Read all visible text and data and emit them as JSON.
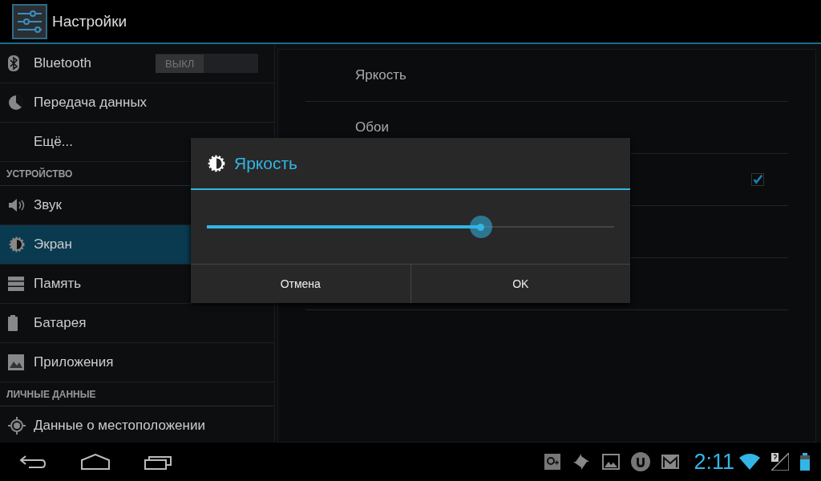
{
  "action_bar": {
    "title": "Настройки"
  },
  "sidebar": {
    "items": [
      {
        "kind": "item",
        "label": "Bluetooth",
        "selected": false,
        "toggle": {
          "label": "ВЫКЛ",
          "on": false
        }
      },
      {
        "kind": "item",
        "label": "Передача данных",
        "selected": false
      },
      {
        "kind": "item",
        "label": "Ещё...",
        "selected": false
      },
      {
        "kind": "header",
        "label": "УСТРОЙСТВО"
      },
      {
        "kind": "item",
        "label": "Звук",
        "selected": false
      },
      {
        "kind": "item",
        "label": "Экран",
        "selected": true
      },
      {
        "kind": "item",
        "label": "Память",
        "selected": false
      },
      {
        "kind": "item",
        "label": "Батарея",
        "selected": false
      },
      {
        "kind": "item",
        "label": "Приложения",
        "selected": false
      },
      {
        "kind": "header",
        "label": "ЛИЧНЫЕ ДАННЫЕ"
      },
      {
        "kind": "item",
        "label": "Данные о местоположении",
        "selected": false
      }
    ]
  },
  "settings": {
    "items": [
      {
        "title": "Яркость"
      },
      {
        "title": "Обои"
      },
      {
        "checked": true
      }
    ]
  },
  "dialog": {
    "title": "Яркость",
    "level": 0.673,
    "buttons": [
      "Отмена",
      "OK"
    ]
  },
  "nav_bar": {
    "clock": "2:11"
  }
}
